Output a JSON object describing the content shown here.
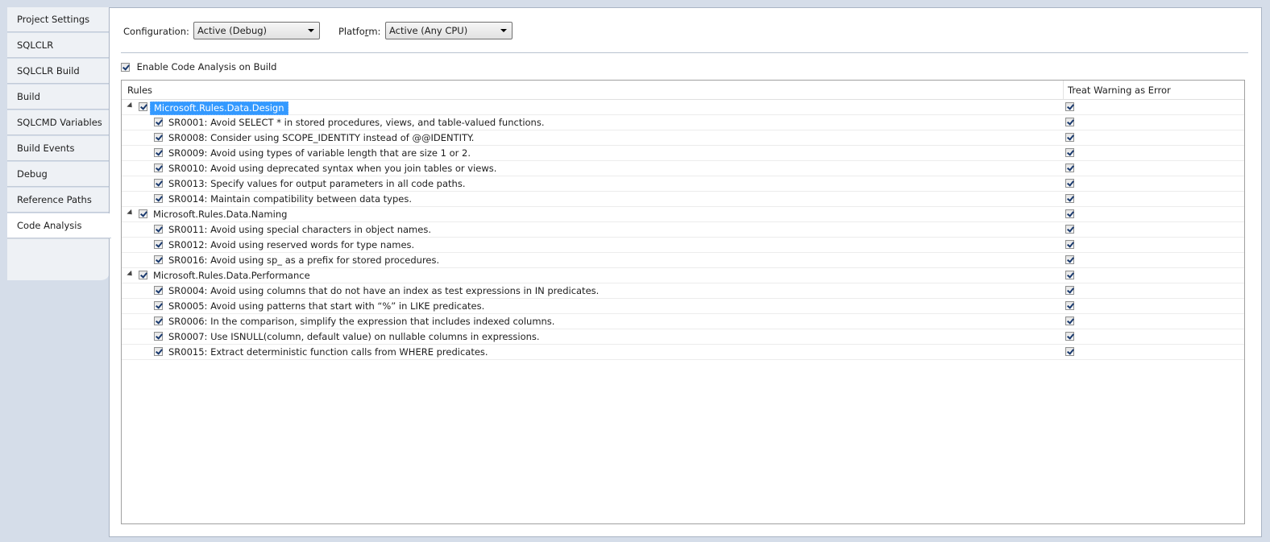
{
  "nav": {
    "items": [
      {
        "label": "Project Settings"
      },
      {
        "label": "SQLCLR"
      },
      {
        "label": "SQLCLR Build"
      },
      {
        "label": "Build"
      },
      {
        "label": "SQLCMD Variables"
      },
      {
        "label": "Build Events"
      },
      {
        "label": "Debug"
      },
      {
        "label": "Reference Paths"
      },
      {
        "label": "Code Analysis"
      }
    ],
    "selected": "Code Analysis"
  },
  "config": {
    "configuration_label": "Configuration:",
    "configuration_value": "Active (Debug)",
    "platform_label_a": "Platfo",
    "platform_label_u": "r",
    "platform_label_b": "m:",
    "platform_value": "Active (Any CPU)"
  },
  "enable": {
    "label": "Enable Code Analysis on Build",
    "checked": true
  },
  "grid": {
    "col_rules": "Rules",
    "col_error": "Treat Warning as Error",
    "groups": [
      {
        "name": "Microsoft.Rules.Data.Design",
        "checked": true,
        "error": true,
        "selected": true,
        "rules": [
          {
            "label": "SR0001: Avoid SELECT * in stored procedures, views, and table-valued functions.",
            "checked": true,
            "error": true
          },
          {
            "label": "SR0008: Consider using SCOPE_IDENTITY instead of @@IDENTITY.",
            "checked": true,
            "error": true
          },
          {
            "label": "SR0009: Avoid using types of variable length that are size 1 or 2.",
            "checked": true,
            "error": true
          },
          {
            "label": "SR0010: Avoid using deprecated syntax when you join tables or views.",
            "checked": true,
            "error": true
          },
          {
            "label": "SR0013: Specify values for output parameters in all code paths.",
            "checked": true,
            "error": true
          },
          {
            "label": "SR0014: Maintain compatibility between data types.",
            "checked": true,
            "error": true
          }
        ]
      },
      {
        "name": "Microsoft.Rules.Data.Naming",
        "checked": true,
        "error": true,
        "selected": false,
        "rules": [
          {
            "label": "SR0011: Avoid using special characters in object names.",
            "checked": true,
            "error": true
          },
          {
            "label": "SR0012: Avoid using reserved words for type names.",
            "checked": true,
            "error": true
          },
          {
            "label": "SR0016: Avoid using sp_ as a prefix for stored procedures.",
            "checked": true,
            "error": true
          }
        ]
      },
      {
        "name": "Microsoft.Rules.Data.Performance",
        "checked": true,
        "error": true,
        "selected": false,
        "rules": [
          {
            "label": "SR0004: Avoid using columns that do not have an index as test expressions in IN predicates.",
            "checked": true,
            "error": true
          },
          {
            "label": "SR0005: Avoid using patterns that start with “%” in LIKE predicates.",
            "checked": true,
            "error": true
          },
          {
            "label": "SR0006: In the comparison, simplify the expression that includes indexed columns.",
            "checked": true,
            "error": true
          },
          {
            "label": "SR0007: Use ISNULL(column, default value) on nullable columns in expressions.",
            "checked": true,
            "error": true
          },
          {
            "label": "SR0015: Extract deterministic function calls from WHERE predicates.",
            "checked": true,
            "error": true
          }
        ]
      }
    ]
  }
}
